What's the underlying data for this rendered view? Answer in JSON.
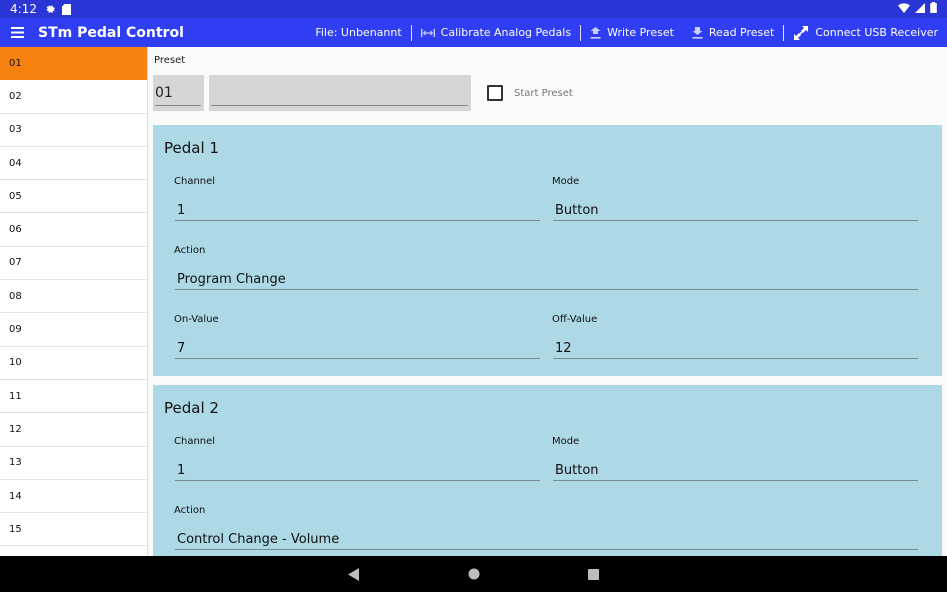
{
  "status_bar": {
    "time": "4:12",
    "icons": [
      "gear-icon",
      "sd-card-icon"
    ],
    "right_icons": [
      "wifi-icon",
      "signal-icon",
      "battery-icon"
    ]
  },
  "app_bar": {
    "title": "STm Pedal Control",
    "file_label": "File: Unbenannt",
    "actions": {
      "calibrate": "Calibrate Analog Pedals",
      "write": "Write Preset",
      "read": "Read Preset",
      "connect": "Connect USB Receiver"
    }
  },
  "sidebar": {
    "items": [
      "01",
      "02",
      "03",
      "04",
      "05",
      "06",
      "07",
      "08",
      "09",
      "10",
      "11",
      "12",
      "13",
      "14",
      "15"
    ],
    "selected": "01"
  },
  "preset": {
    "label": "Preset",
    "number": "01",
    "name": "",
    "start_label": "Start Preset",
    "start_checked": false
  },
  "pedals": [
    {
      "title": "Pedal 1",
      "channel_label": "Channel",
      "channel": "1",
      "mode_label": "Mode",
      "mode": "Button",
      "action_label": "Action",
      "action": "Program Change",
      "on_label": "On-Value",
      "on_value": "7",
      "off_label": "Off-Value",
      "off_value": "12"
    },
    {
      "title": "Pedal 2",
      "channel_label": "Channel",
      "channel": "1",
      "mode_label": "Mode",
      "mode": "Button",
      "action_label": "Action",
      "action": "Control Change - Volume"
    }
  ],
  "colors": {
    "status_bar": "#2a35d6",
    "app_bar": "#2f3ef2",
    "selected_item": "#f7820f",
    "panel": "#add8e6"
  }
}
